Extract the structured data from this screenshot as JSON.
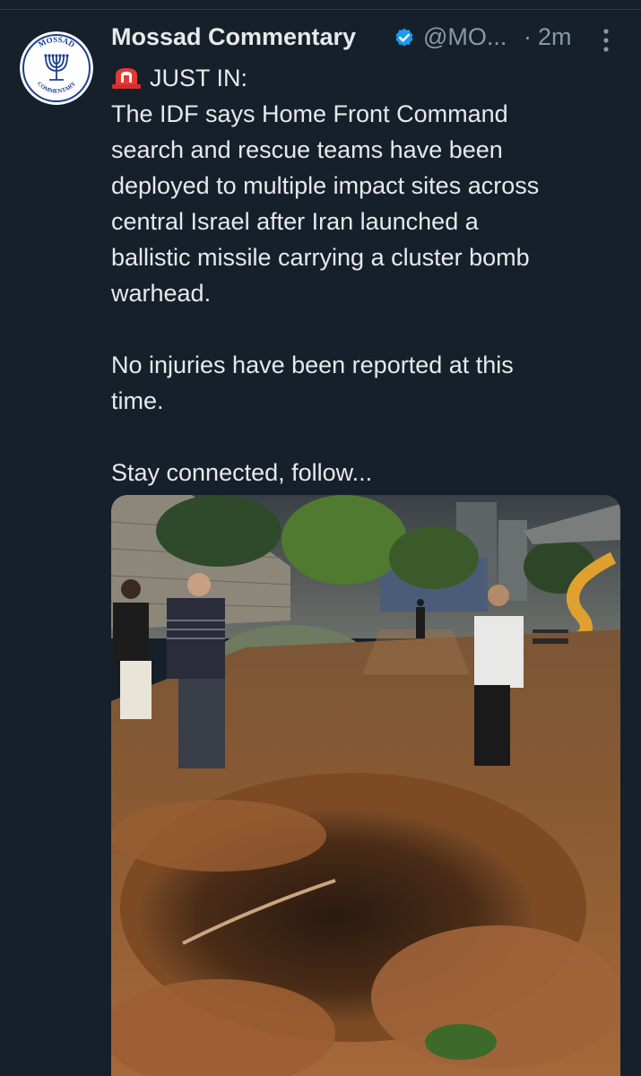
{
  "post": {
    "author": {
      "display_name": "Mossad Commentary",
      "handle": "@MO...",
      "verified": true,
      "avatar": {
        "logo_text_top": "MOSSAD",
        "logo_text_bottom": "COMMENTARY",
        "icon": "menorah-seal-icon"
      }
    },
    "separator": "·",
    "timestamp": "2m",
    "more_icon": "more-vertical-icon",
    "alert_icon": "siren-emoji-icon",
    "body": {
      "line1": "JUST IN:",
      "line2": "The IDF says Home Front Command",
      "line3": "search and rescue teams have been",
      "line4": "deployed to multiple impact sites across",
      "line5": "central Israel after Iran launched a",
      "line6": "ballistic missile carrying a cluster bomb",
      "line7": "warhead.",
      "line8": "No injuries have been reported at this",
      "line9": "time.",
      "line10": "Stay connected, follow..."
    },
    "media": {
      "type": "photo",
      "description_icon": "photo-impact-crater"
    }
  },
  "colors": {
    "background": "#15202b",
    "text": "#e7e9ea",
    "secondary_text": "#8b98a5",
    "verified": "#1d9bf0"
  }
}
